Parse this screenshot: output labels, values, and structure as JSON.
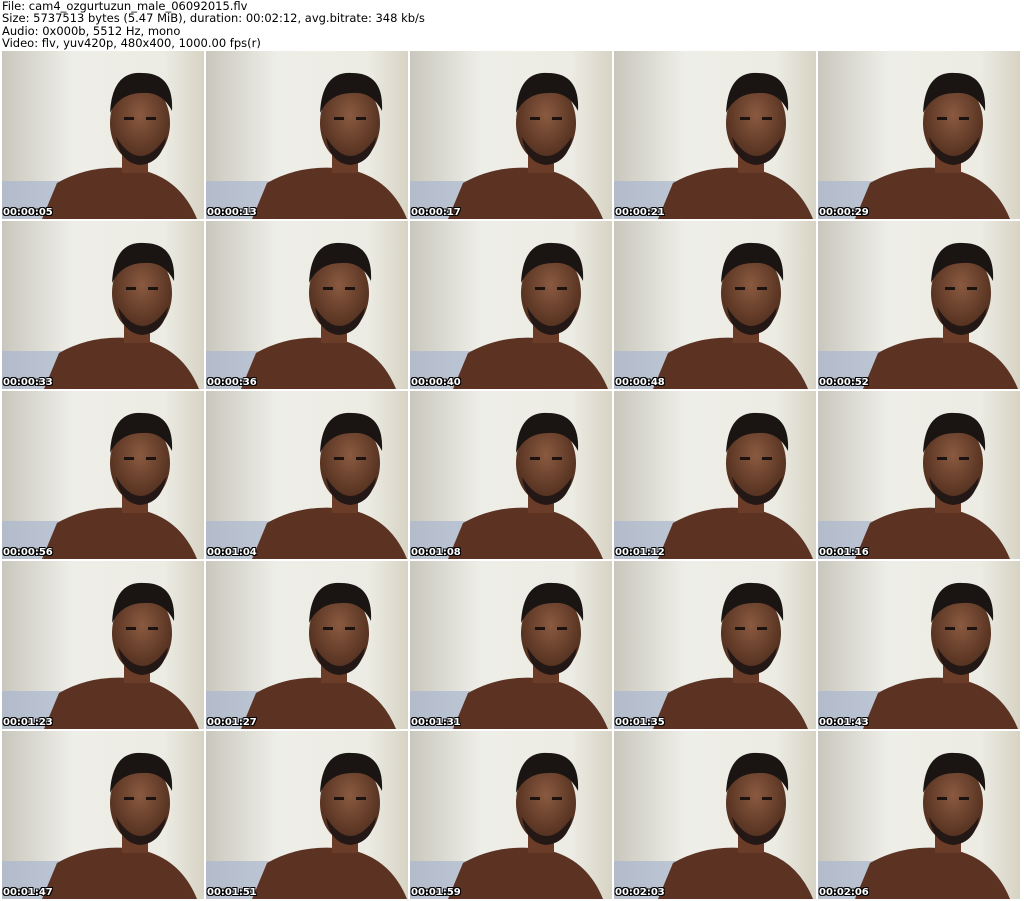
{
  "header": {
    "line1": "File: cam4_ozgurtuzun_male_06092015.flv",
    "line2": "Size: 5737513 bytes (5.47 MiB), duration: 00:02:12, avg.bitrate: 348 kb/s",
    "line3": "Audio: 0x000b, 5512 Hz, mono",
    "line4": "Video: flv, yuv420p, 480x400, 1000.00 fps(r)"
  },
  "thumbnails": [
    {
      "timestamp": "00:00:05"
    },
    {
      "timestamp": "00:00:13"
    },
    {
      "timestamp": "00:00:17"
    },
    {
      "timestamp": "00:00:21"
    },
    {
      "timestamp": "00:00:29"
    },
    {
      "timestamp": "00:00:33"
    },
    {
      "timestamp": "00:00:36"
    },
    {
      "timestamp": "00:00:40"
    },
    {
      "timestamp": "00:00:48"
    },
    {
      "timestamp": "00:00:52"
    },
    {
      "timestamp": "00:00:56"
    },
    {
      "timestamp": "00:01:04"
    },
    {
      "timestamp": "00:01:08"
    },
    {
      "timestamp": "00:01:12"
    },
    {
      "timestamp": "00:01:16"
    },
    {
      "timestamp": "00:01:23"
    },
    {
      "timestamp": "00:01:27"
    },
    {
      "timestamp": "00:01:31"
    },
    {
      "timestamp": "00:01:35"
    },
    {
      "timestamp": "00:01:43"
    },
    {
      "timestamp": "00:01:47"
    },
    {
      "timestamp": "00:01:51"
    },
    {
      "timestamp": "00:01:59"
    },
    {
      "timestamp": "00:02:03"
    },
    {
      "timestamp": "00:02:06"
    }
  ]
}
